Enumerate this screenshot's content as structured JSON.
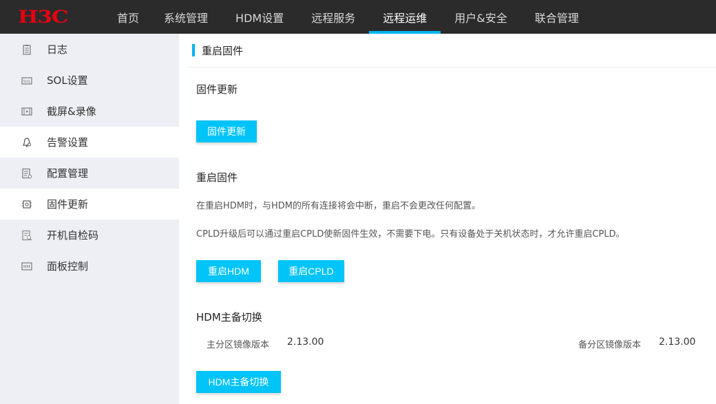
{
  "brand": {
    "logo_text": "H3C",
    "logo_color": "#e60012"
  },
  "colors": {
    "accent": "#00b4f0",
    "button": "#00c4f7",
    "topbar": "#2b2b2b",
    "sidebar": "#eeeff5"
  },
  "nav": {
    "items": [
      {
        "label": "首页"
      },
      {
        "label": "系统管理"
      },
      {
        "label": "HDM设置"
      },
      {
        "label": "远程服务"
      },
      {
        "label": "远程运维",
        "active": true
      },
      {
        "label": "用户&安全"
      },
      {
        "label": "联合管理"
      }
    ]
  },
  "sidebar": {
    "items": [
      {
        "label": "日志",
        "icon": "log-icon"
      },
      {
        "label": "SOL设置",
        "icon": "sol-icon"
      },
      {
        "label": "截屏&录像",
        "icon": "video-icon"
      },
      {
        "label": "告警设置",
        "icon": "bell-icon"
      },
      {
        "label": "配置管理",
        "icon": "config-icon"
      },
      {
        "label": "固件更新",
        "icon": "firmware-icon"
      },
      {
        "label": "开机自检码",
        "icon": "post-code-icon"
      },
      {
        "label": "面板控制",
        "icon": "panel-icon"
      }
    ]
  },
  "page": {
    "title": "重启固件",
    "firmware_update": {
      "title": "固件更新",
      "button": "固件更新"
    },
    "restart": {
      "title": "重启固件",
      "desc1": "在重启HDM时，与HDM的所有连接将会中断，重启不会更改任何配置。",
      "desc2": "CPLD升级后可以通过重启CPLD使新固件生效，不需要下电。只有设备处于关机状态时，才允许重启CPLD。",
      "btn_hdm": "重启HDM",
      "btn_cpld": "重启CPLD"
    },
    "switch": {
      "title": "HDM主备切换",
      "primary_label": "主分区镜像版本",
      "primary_value": "2.13.00",
      "backup_label": "备分区镜像版本",
      "backup_value": "2.13.00",
      "button": "HDM主备切换"
    }
  }
}
